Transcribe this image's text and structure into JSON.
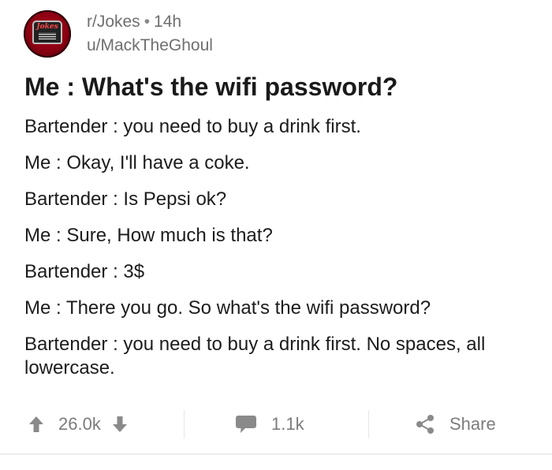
{
  "post": {
    "subreddit": "r/Jokes",
    "separator": "•",
    "age": "14h",
    "author": "u/MackTheGhoul",
    "avatar_logo_text": "Jokes",
    "title": "Me : What's the wifi password?",
    "lines": [
      "Bartender : you need to buy a drink first.",
      "Me : Okay, I'll have a coke.",
      "Bartender : Is Pepsi ok?",
      "Me : Sure, How much is that?",
      "Bartender : 3$",
      "Me : There you go. So what's the wifi password?",
      "Bartender : you need to buy a drink first. No spaces, all lowercase."
    ]
  },
  "actions": {
    "score": "26.0k",
    "comments": "1.1k",
    "share_label": "Share",
    "icons": {
      "upvote": "arrow-up-icon",
      "downvote": "arrow-down-icon",
      "comment": "speech-bubble-icon",
      "share": "share-icon"
    },
    "icon_color": "#8a8a8a"
  },
  "colors": {
    "avatar_red": "#8a0012",
    "text": "#1a1a1b",
    "meta_text": "#6f6f6f"
  }
}
